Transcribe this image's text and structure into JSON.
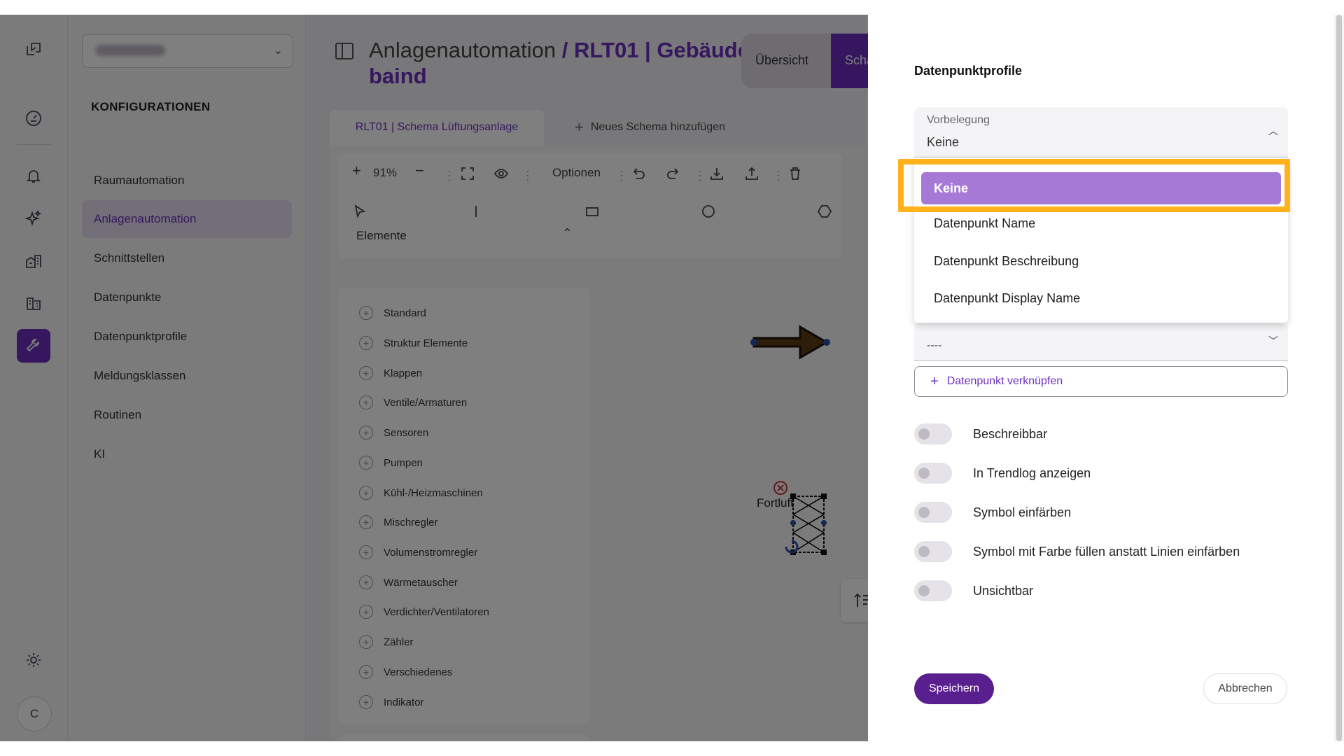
{
  "app": {
    "avatar_initial": "C"
  },
  "sidebar": {
    "heading": "KONFIGURATIONEN",
    "items": [
      {
        "label": "Raumautomation"
      },
      {
        "label": "Anlagenautomation"
      },
      {
        "label": "Schnittstellen"
      },
      {
        "label": "Datenpunkte"
      },
      {
        "label": "Datenpunktprofile"
      },
      {
        "label": "Meldungsklassen"
      },
      {
        "label": "Routinen"
      },
      {
        "label": "KI"
      }
    ]
  },
  "header": {
    "title_part1": "Anlagenautomation",
    "title_sep": " / ",
    "title_part2": "RLT01 | Gebäude baind",
    "segment_overview": "Übersicht",
    "segment_schema": "Scha"
  },
  "tabs": {
    "active": "RLT01 | Schema Lüftungsanlage",
    "add": "Neues Schema hinzufügen"
  },
  "toolbar": {
    "zoom": "91%",
    "options": "Optionen"
  },
  "elements": {
    "heading": "Elemente",
    "items": [
      "Standard",
      "Struktur Elemente",
      "Klappen",
      "Ventile/Armaturen",
      "Sensoren",
      "Pumpen",
      "Kühl-/Heizmaschinen",
      "Mischregler",
      "Volumenstromregler",
      "Wärmetauscher",
      "Verdichter/Ventilatoren",
      "Zähler",
      "Verschiedenes",
      "Indikator"
    ]
  },
  "canvas": {
    "arrow_label": "Fortluft"
  },
  "drawer": {
    "title": "Datenpunktprofile",
    "preset_label": "Vorbelegung",
    "preset_value": "Keine",
    "options": [
      "Keine",
      "Datenpunkt Name",
      "Datenpunkt Beschreibung",
      "Datenpunkt Display Name"
    ],
    "second_select_value": "----",
    "link_button": "Datenpunkt verknüpfen",
    "toggles": [
      {
        "label": "Beschreibbar",
        "on": false
      },
      {
        "label": "In Trendlog anzeigen",
        "on": false
      },
      {
        "label": "Symbol einfärben",
        "on": false
      },
      {
        "label": "Symbol mit Farbe füllen anstatt Linien einfärben",
        "on": false
      },
      {
        "label": "Unsichtbar",
        "on": false
      }
    ],
    "save": "Speichern",
    "cancel": "Abbrechen"
  },
  "colors": {
    "accent": "#6c2fbf",
    "option_selected": "#a779d6",
    "highlight": "#ffb21c"
  }
}
